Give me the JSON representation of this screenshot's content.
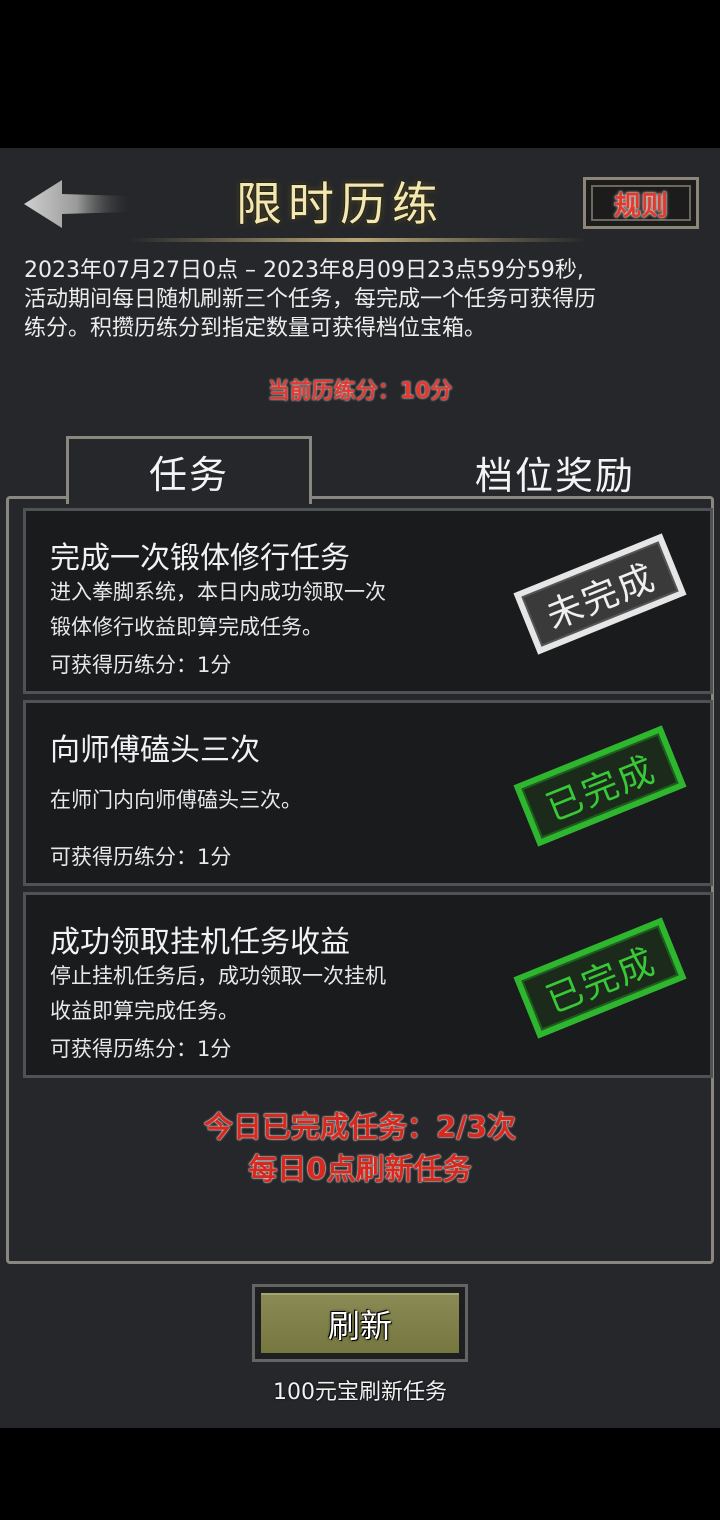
{
  "header": {
    "title": "限时历练",
    "rules_label": "规则"
  },
  "description": {
    "line1": "2023年07月27日0点 – 2023年8月09日23点59分59秒,",
    "line2": "活动期间每日随机刷新三个任务，每完成一个任务可获得历",
    "line3": "练分。积攒历练分到指定数量可获得档位宝箱。"
  },
  "score_text": "当前历练分：10分",
  "tabs": [
    {
      "label": "任务",
      "active": true
    },
    {
      "label": "档位奖励",
      "active": false
    }
  ],
  "tasks": [
    {
      "title": "完成一次锻体修行任务",
      "desc1": "进入拳脚系统，本日内成功领取一次",
      "desc2": "锻体修行收益即算完成任务。",
      "points": "可获得历练分：1分",
      "status": "未完成"
    },
    {
      "title": "向师傅磕头三次",
      "desc1": "在师门内向师傅磕头三次。",
      "desc2": "",
      "points": "可获得历练分：1分",
      "status": "已完成"
    },
    {
      "title": "成功领取挂机任务收益",
      "desc1": "停止挂机任务后，成功领取一次挂机",
      "desc2": "收益即算完成任务。",
      "points": "可获得历练分：1分",
      "status": "已完成"
    }
  ],
  "summary": {
    "completed": "今日已完成任务：2/3次",
    "refresh_note": "每日0点刷新任务"
  },
  "refresh": {
    "label": "刷新",
    "cost": "100元宝刷新任务"
  },
  "colors": {
    "title": "#f3e7b2",
    "accent_red": "#e03a32",
    "done_green": "#2fb62f",
    "button": "#76763f"
  },
  "icons": {
    "back": "back-arrow-icon"
  }
}
